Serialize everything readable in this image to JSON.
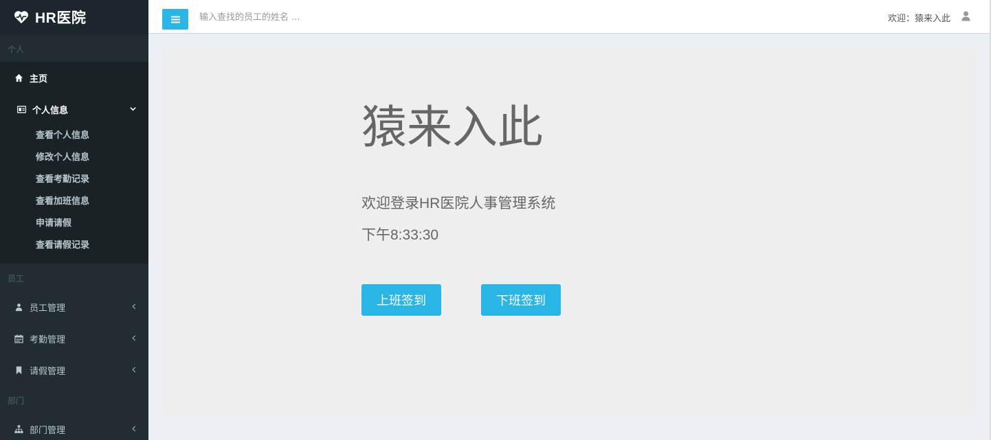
{
  "app": {
    "logo_text": "HR医院"
  },
  "sidebar": {
    "sections": [
      {
        "label": "个人"
      },
      {
        "label": "员工"
      },
      {
        "label": "部门"
      }
    ],
    "home": {
      "label": "主页",
      "icon": "home-icon"
    },
    "personal": {
      "label": "个人信息",
      "icon": "id-card-icon",
      "items": [
        {
          "label": "查看个人信息"
        },
        {
          "label": "修改个人信息"
        },
        {
          "label": "查看考勤记录"
        },
        {
          "label": "查看加班信息"
        },
        {
          "label": "申请请假"
        },
        {
          "label": "查看请假记录"
        }
      ]
    },
    "employee_menu": [
      {
        "label": "员工管理",
        "icon": "users-icon"
      },
      {
        "label": "考勤管理",
        "icon": "calendar-icon"
      },
      {
        "label": "请假管理",
        "icon": "bookmark-icon"
      }
    ],
    "department_menu": [
      {
        "label": "部门管理",
        "icon": "sitemap-icon"
      }
    ]
  },
  "header": {
    "search_placeholder": "输入查找的员工的姓名 ...",
    "welcome": "欢迎：猿来入此"
  },
  "main": {
    "title": "猿来入此",
    "subtitle": "欢迎登录HR医院人事管理系统",
    "time": "下午8:33:30",
    "checkin_label": "上班签到",
    "checkout_label": "下班签到"
  },
  "colors": {
    "accent": "#29b6e6",
    "sidebar_bg": "#222d32",
    "content_bg": "#ecf0f5"
  }
}
